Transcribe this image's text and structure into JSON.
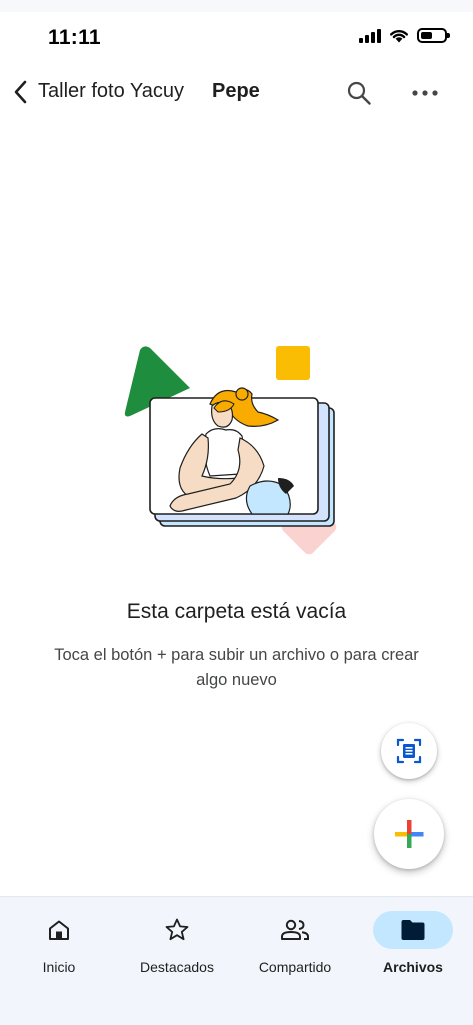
{
  "status_bar": {
    "time": "11:11"
  },
  "header": {
    "parent_folder": "Taller foto Yacuy",
    "current_folder": "Pepe"
  },
  "icons": {
    "back": "chevron-left-icon",
    "search": "search-icon",
    "more": "more-horizontal-icon",
    "scan": "document-scan-icon",
    "new": "multicolor-plus-icon"
  },
  "empty_state": {
    "title": "Esta carpeta está vacía",
    "subtitle": "Toca el botón + para subir un archivo o para crear algo nuevo"
  },
  "bottom_nav": {
    "items": [
      {
        "label": "Inicio",
        "icon": "home-icon",
        "active": false
      },
      {
        "label": "Destacados",
        "icon": "star-icon",
        "active": false
      },
      {
        "label": "Compartido",
        "icon": "people-icon",
        "active": false
      },
      {
        "label": "Archivos",
        "icon": "folder-icon",
        "active": true
      }
    ]
  },
  "colors": {
    "active_nav_pill": "#c2e7ff",
    "nav_background": "#f2f6fc",
    "google_blue": "#4285f4",
    "google_red": "#ea4335",
    "google_yellow": "#fbbc04",
    "google_green": "#34a853"
  }
}
